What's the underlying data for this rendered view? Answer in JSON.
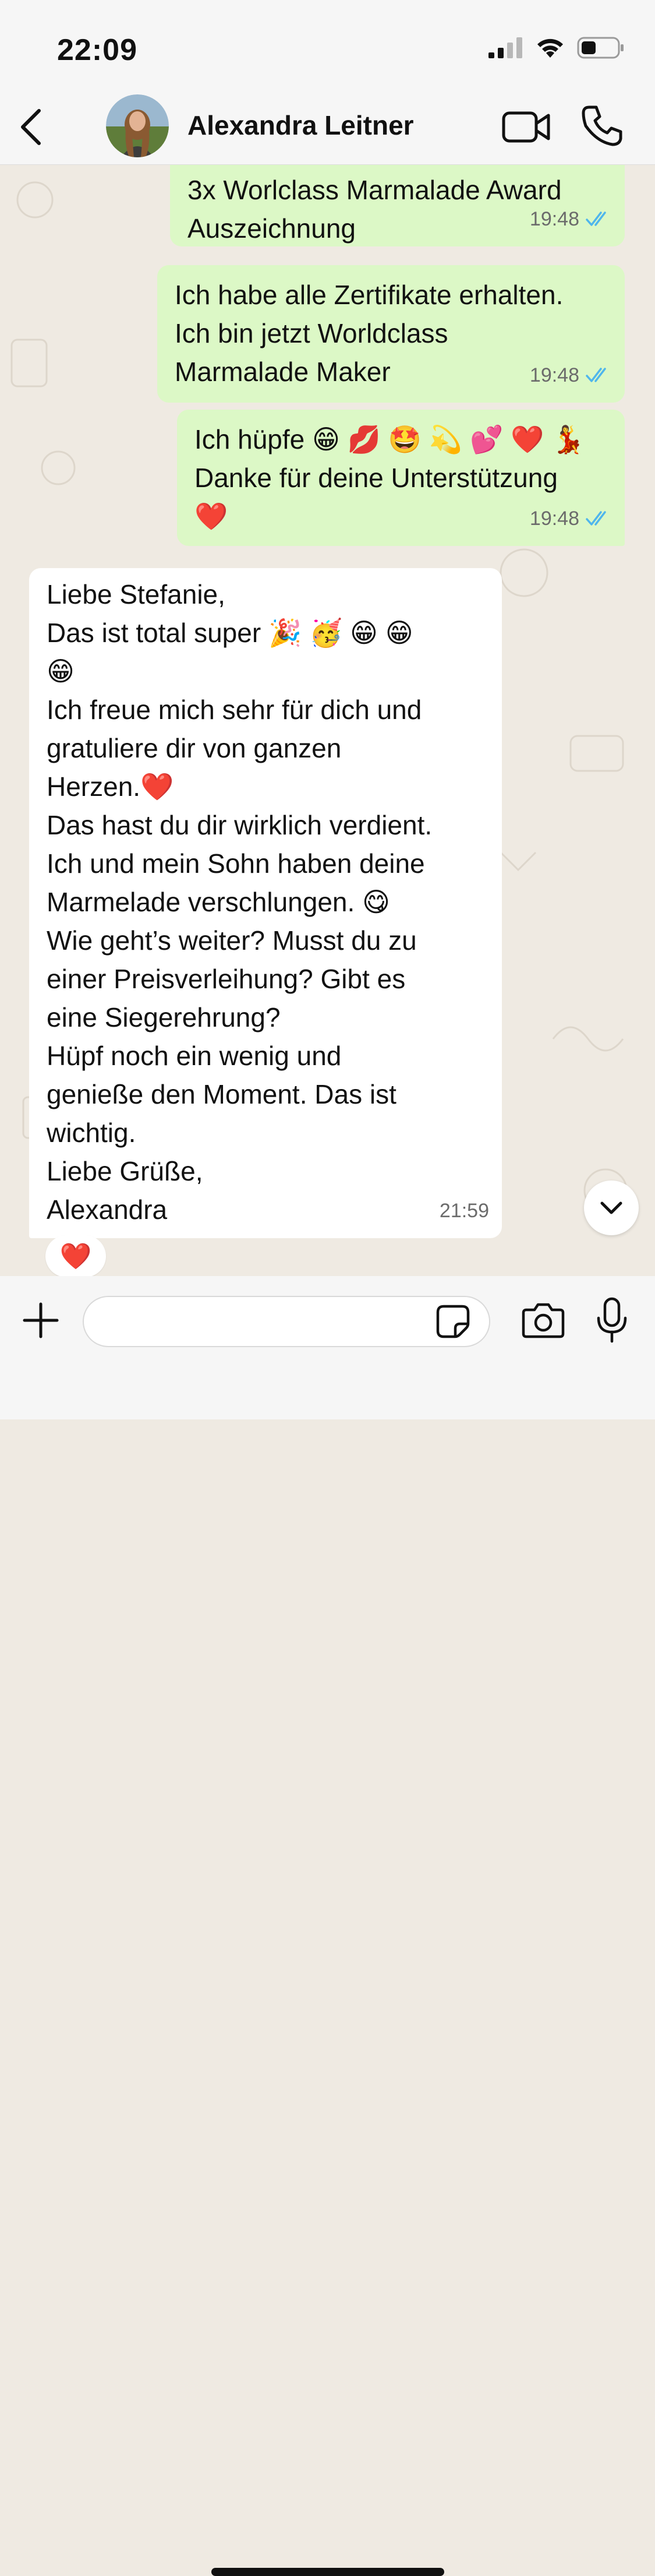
{
  "status_bar": {
    "time": "22:09"
  },
  "header": {
    "contact_name": "Alexandra Leitner"
  },
  "messages": [
    {
      "direction": "out",
      "text": "3x Worlclass Marmalade Award\nAuszeichnung",
      "time": "19:48",
      "status": "read"
    },
    {
      "direction": "out",
      "text": "Ich habe alle Zertifikate erhalten.\nIch bin jetzt Worldclass\nMarmalade Maker",
      "time": "19:48",
      "status": "read"
    },
    {
      "direction": "out",
      "text": "Ich hüpfe 😁 💋 🤩 💫 💕 ❤️ 💃\nDanke für deine Unterstützung\n❤️",
      "time": "19:48",
      "status": "read"
    },
    {
      "direction": "in",
      "text": "Liebe Stefanie,\nDas ist total super 🎉 🥳 😁 😁\n😁\nIch freue mich sehr für dich und\ngratuliere dir von ganzen\nHerzen.❤️\nDas hast du dir wirklich verdient.\nIch und mein Sohn haben deine\nMarmelade verschlungen. 😋\nWie geht’s weiter? Musst du zu\neiner Preisverleihung? Gibt es\neine Siegerehrung?\nHüpf noch ein wenig und\ngenieße den Moment. Das ist\nwichtig.\nLiebe Grüße,\nAlexandra",
      "time": "21:59",
      "reaction": "❤️"
    }
  ],
  "input": {
    "placeholder": "",
    "value": ""
  },
  "colors": {
    "outgoing_bubble": "#dcf8c6",
    "incoming_bubble": "#ffffff",
    "read_ticks": "#4fb6ec",
    "background": "#efeae2"
  },
  "icons": [
    "back-chevron-icon",
    "video-camera-icon",
    "phone-icon",
    "plus-icon",
    "sticker-icon",
    "camera-icon",
    "microphone-icon",
    "chevron-down-icon",
    "double-check-icon",
    "signal-icon",
    "wifi-icon",
    "battery-icon"
  ]
}
